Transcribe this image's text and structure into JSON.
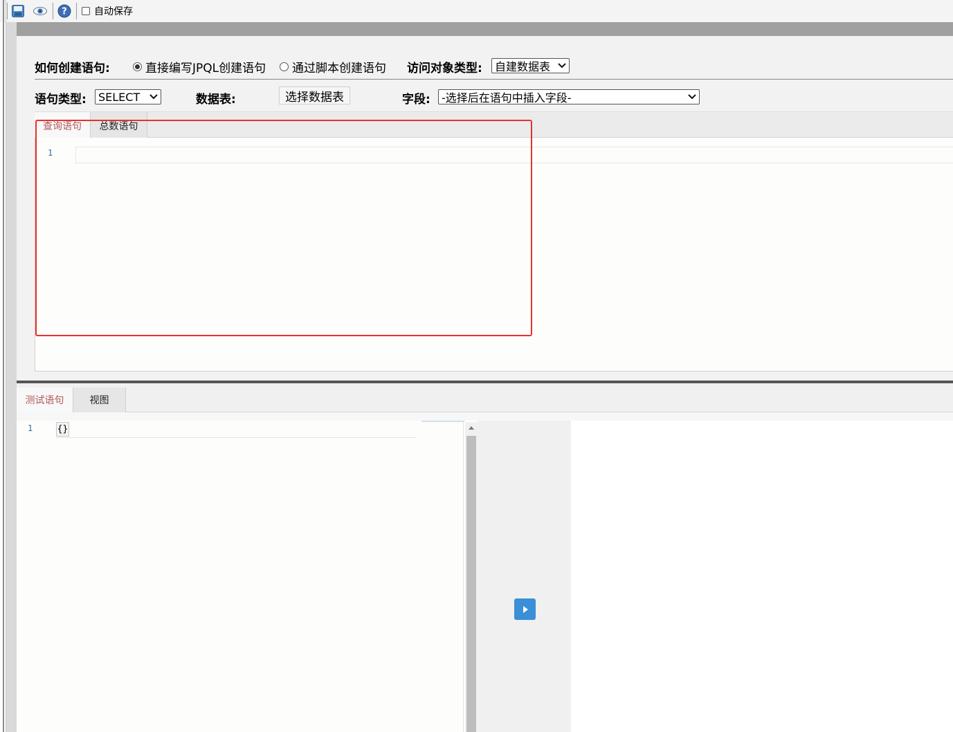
{
  "toolbar": {
    "icons": [
      "save-icon",
      "preview-eye-icon",
      "help-icon"
    ],
    "autosave_label": "自动保存",
    "autosave_checked": false
  },
  "form": {
    "how_create_label": "如何创建语句:",
    "radio_options": [
      {
        "label": "直接编写JPQL创建语句",
        "selected": true
      },
      {
        "label": "通过脚本创建语句",
        "selected": false
      }
    ],
    "access_type_label": "访问对象类型:",
    "access_type_value": "自建数据表",
    "statement_type_label": "语句类型:",
    "statement_type_value": "SELECT",
    "data_table_label": "数据表:",
    "data_table_button": "选择数据表",
    "field_label": "字段:",
    "field_placeholder": "-选择后在语句中插入字段-"
  },
  "query_tabs": [
    {
      "label": "查询语句",
      "active": true
    },
    {
      "label": "总数语句",
      "active": false
    }
  ],
  "query_editor": {
    "line_number": "1",
    "content": ""
  },
  "lower_tabs": [
    {
      "label": "测试语句",
      "active": true
    },
    {
      "label": "视图",
      "active": false
    }
  ],
  "test_editor": {
    "line_number": "1",
    "content": "{}"
  },
  "colors": {
    "highlight_box": "#e8302a",
    "active_tab_text": "#b05a5a",
    "run_button": "#3b8fd6"
  }
}
